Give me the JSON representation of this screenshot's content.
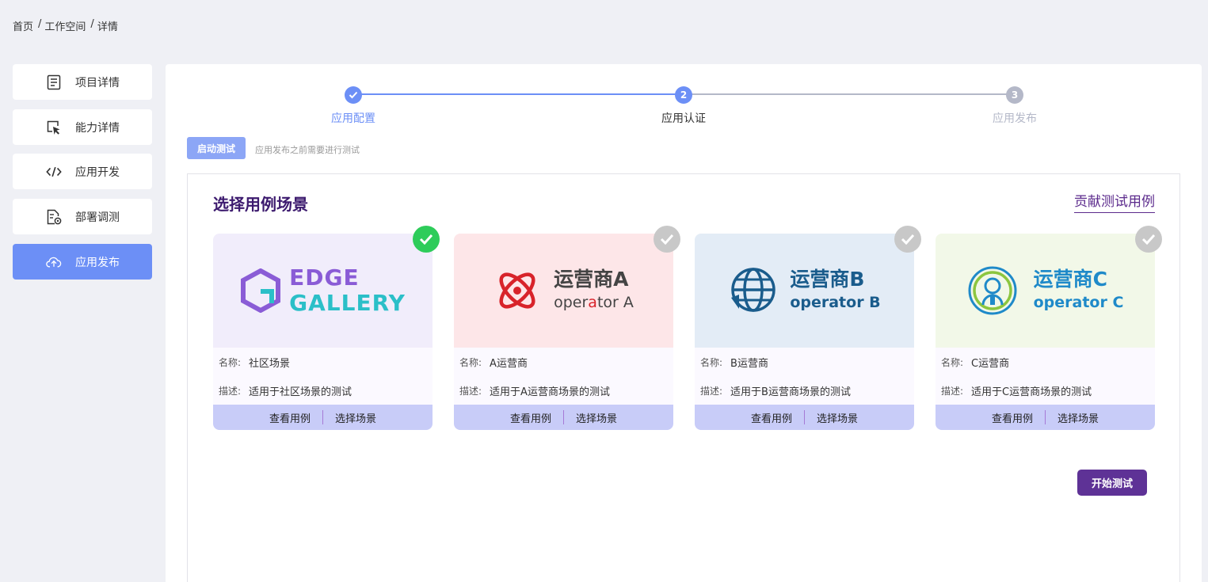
{
  "breadcrumb": {
    "home": "首页",
    "workspace": "工作空间",
    "detail": "详情",
    "sep": "/"
  },
  "sidebar": {
    "items": [
      {
        "label": "项目详情",
        "icon": "document-icon"
      },
      {
        "label": "能力详情",
        "icon": "cursor-click-icon"
      },
      {
        "label": "应用开发",
        "icon": "code-icon"
      },
      {
        "label": "部署调测",
        "icon": "deploy-debug-icon"
      },
      {
        "label": "应用发布",
        "icon": "cloud-upload-icon",
        "active": true
      }
    ]
  },
  "steps": {
    "items": [
      {
        "label": "应用配置",
        "status": "done"
      },
      {
        "label": "应用认证",
        "number": "2",
        "status": "current"
      },
      {
        "label": "应用发布",
        "number": "3",
        "status": "pending"
      }
    ],
    "colors": {
      "done": "#6c8ff6",
      "pending": "#b4b8c8"
    }
  },
  "launch": {
    "button_label": "启动测试",
    "tip": "应用发布之前需要进行测试"
  },
  "panel": {
    "title": "选择用例场景",
    "contribute_link": "贡献测试用例",
    "start_button": "开始测试"
  },
  "cards": [
    {
      "name_label": "名称:",
      "name": "社区场景",
      "desc_label": "描述:",
      "desc": "适用于社区场景的测试",
      "view": "查看用例",
      "select": "选择场景",
      "selected": true,
      "logo_line1": "EDGE",
      "logo_line2": "GALLERY",
      "bg": "#f1edfb"
    },
    {
      "name_label": "名称:",
      "name": "A运营商",
      "desc_label": "描述:",
      "desc": "适用于A运营商场景的测试",
      "view": "查看用例",
      "select": "选择场景",
      "selected": false,
      "logo_cn": "运营商A",
      "logo_en_1": "oper",
      "logo_en_2": "a",
      "logo_en_3": "tor A",
      "bg": "#fde6e8"
    },
    {
      "name_label": "名称:",
      "name": "B运营商",
      "desc_label": "描述:",
      "desc": "适用于B运营商场景的测试",
      "view": "查看用例",
      "select": "选择场景",
      "selected": false,
      "logo_cn": "运营商B",
      "logo_en": "operator B",
      "bg": "#e3ecf6"
    },
    {
      "name_label": "名称:",
      "name": "C运营商",
      "desc_label": "描述:",
      "desc": "适用于C运营商场景的测试",
      "view": "查看用例",
      "select": "选择场景",
      "selected": false,
      "logo_cn": "运营商C",
      "logo_en": "operator C",
      "bg": "#f2f8e8"
    }
  ]
}
